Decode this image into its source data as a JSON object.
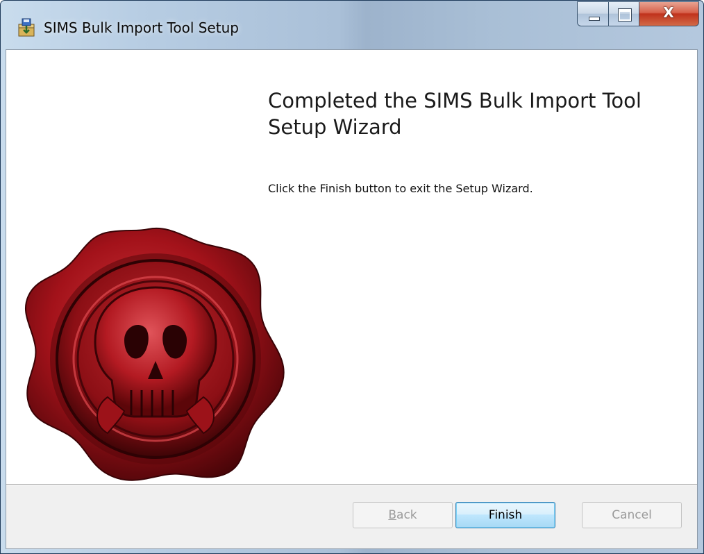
{
  "window": {
    "title": "SIMS Bulk Import Tool Setup",
    "icon": "installer-package-icon"
  },
  "caption_buttons": {
    "minimize": "minimize-icon",
    "maximize": "maximize-icon",
    "close_glyph": "X"
  },
  "wizard": {
    "heading": "Completed the SIMS Bulk Import Tool Setup Wizard",
    "description": "Click the Finish button to exit the Setup Wizard.",
    "graphic": "red-wax-seal-skull-image"
  },
  "buttons": {
    "back_mnemonic": "B",
    "back_rest": "ack",
    "back_enabled": false,
    "finish": "Finish",
    "finish_enabled": true,
    "cancel": "Cancel",
    "cancel_enabled": false
  },
  "colors": {
    "accent_default_button": "#3c7fb1",
    "close_button": "#c0321c",
    "seal_red": "#a3121a"
  }
}
